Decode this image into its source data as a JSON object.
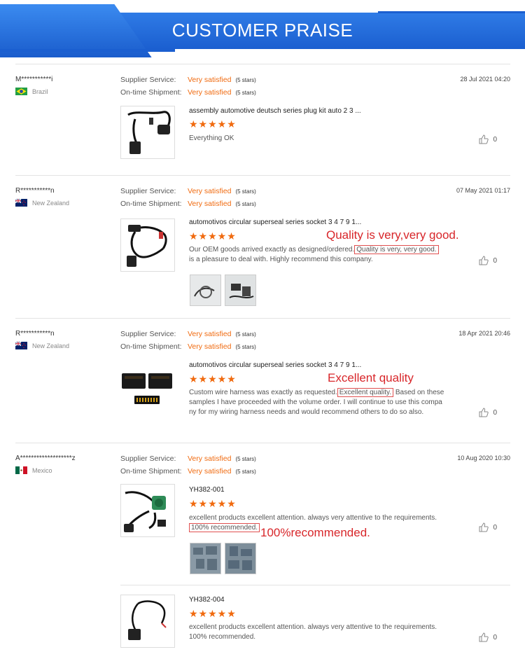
{
  "header": {
    "title": "CUSTOMER PRAISE"
  },
  "labels": {
    "supplier_service": "Supplier Service:",
    "ontime_shipment": "On-time Shipment:"
  },
  "reviews": [
    {
      "reviewer": "M***********i",
      "country": "Brazil",
      "supplier_value": "Very satisfied",
      "supplier_stars": "(5 stars)",
      "shipment_value": "Very satisfied",
      "shipment_stars": "(5 stars)",
      "date": "28 Jul 2021 04:20",
      "product_title": "assembly automotive deutsch series plug kit auto 2 3 ...",
      "rating_stars": "★★★★★",
      "comment": "Everything OK",
      "likes": "0"
    },
    {
      "reviewer": "R***********n",
      "country": "New Zealand",
      "supplier_value": "Very satisfied",
      "supplier_stars": "(5 stars)",
      "shipment_value": "Very satisfied",
      "shipment_stars": "(5 stars)",
      "date": "07 May 2021 01:17",
      "product_title": "automotivos circular superseal series socket 3 4 7 9 1...",
      "rating_stars": "★★★★★",
      "comment_pre": "Our OEM goods arrived exactly as designed/ordered.",
      "comment_highlight": "Quality is very, very good.",
      "comment_post": "is a pleasure to deal with. Highly recommend this company.",
      "callout": "Quality is very,very good.",
      "likes": "0"
    },
    {
      "reviewer": "R***********n",
      "country": "New Zealand",
      "supplier_value": "Very satisfied",
      "supplier_stars": "(5 stars)",
      "shipment_value": "Very satisfied",
      "shipment_stars": "(5 stars)",
      "date": "18 Apr 2021 20:46",
      "product_title": "automotivos circular superseal series socket 3 4 7 9 1...",
      "rating_stars": "★★★★★",
      "comment_pre": "Custom wire harness was exactly as requested.",
      "comment_highlight": "Excellent quality.",
      "comment_mid": "Based on these",
      "comment_line2": "samples I have proceeded with the volume order. I will continue to use this compa",
      "comment_line3": "ny for my wiring harness needs and would recommend others to do so also.",
      "callout": "Excellent quality",
      "likes": "0"
    },
    {
      "reviewer": "A*******************z",
      "country": "Mexico",
      "supplier_value": "Very satisfied",
      "supplier_stars": "(5 stars)",
      "shipment_value": "Very satisfied",
      "shipment_stars": "(5 stars)",
      "date": "10 Aug 2020 10:30",
      "product_title": "YH382-001",
      "rating_stars": "★★★★★",
      "comment_line1": "excellent products excellent attention. always very attentive to the requirements.",
      "comment_highlight": "100% recommended.",
      "callout": "100%recommended.",
      "likes": "0"
    },
    {
      "product_title": "YH382-004",
      "rating_stars": "★★★★★",
      "comment_line1": "excellent products excellent attention. always very attentive to the requirements.",
      "comment_line2": "100% recommended.",
      "likes": "0"
    }
  ],
  "colors": {
    "accent": "#f06a0f",
    "banner": "#1b5fd0",
    "callout": "#d8262a"
  }
}
